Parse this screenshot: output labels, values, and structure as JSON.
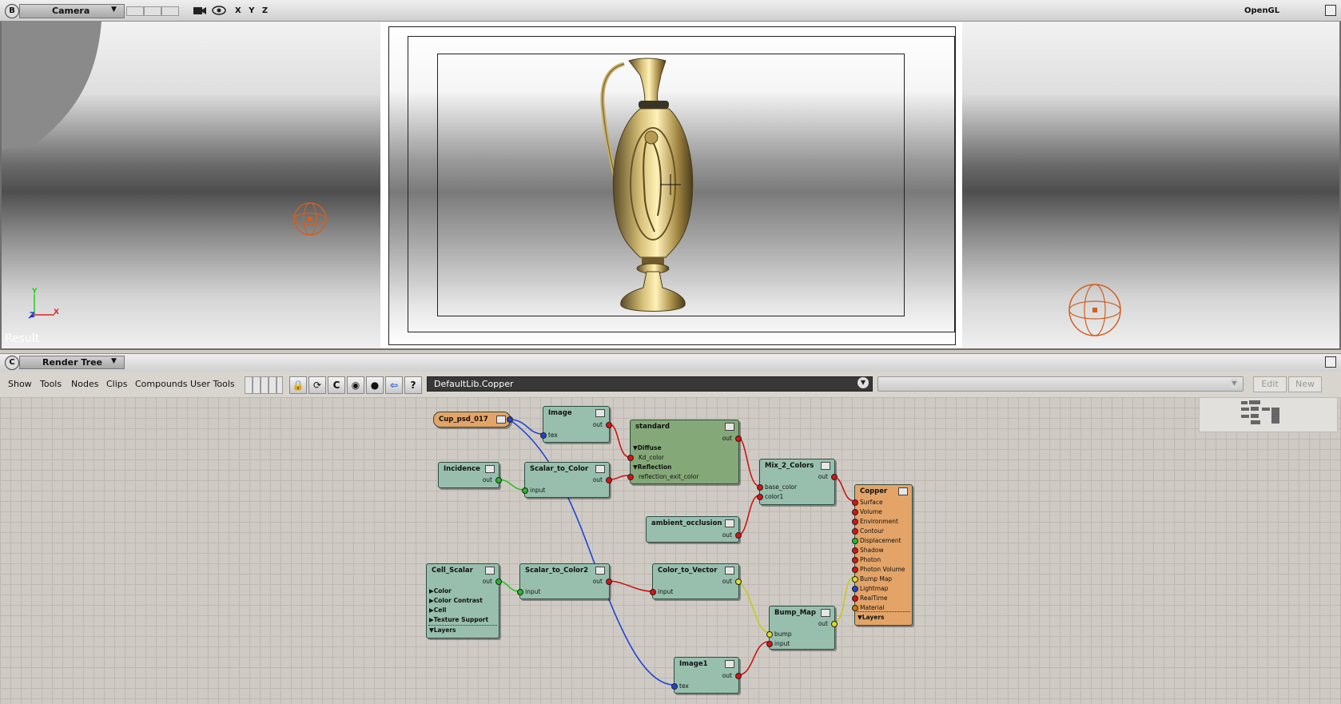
{
  "viewport": {
    "badge": "B",
    "camera_label": "Camera",
    "axes_label": "X Y Z",
    "renderer": "OpenGL",
    "mode_label": "Result",
    "axis_y": "Y",
    "axis_x": "X",
    "axis_z": "Z"
  },
  "render_tree": {
    "badge": "C",
    "title": "Render Tree",
    "menu": [
      "Show",
      "Tools",
      "Nodes",
      "Clips",
      "Compounds",
      "User Tools"
    ],
    "path": "DefaultLib.Copper",
    "edit_label": "Edit",
    "new_label": "New"
  },
  "nodes": {
    "cup": {
      "title": "Cup_psd_017"
    },
    "image": {
      "title": "Image",
      "out": "out",
      "tex": "tex"
    },
    "standard": {
      "title": "standard",
      "out": "out",
      "diffuse": "▼Diffuse",
      "kd_color": "Kd_color",
      "reflection": "▼Reflection",
      "refl_exit": "reflection_exit_color"
    },
    "incidence": {
      "title": "Incidence",
      "out": "out"
    },
    "s2c": {
      "title": "Scalar_to_Color",
      "out": "out",
      "input": "input"
    },
    "mix": {
      "title": "Mix_2_Colors",
      "out": "out",
      "base": "base_color",
      "color1": "color1"
    },
    "ao": {
      "title": "ambient_occlusion",
      "out": "out"
    },
    "cell": {
      "title": "Cell_Scalar",
      "out": "out",
      "color": "▶Color",
      "contrast": "▶Color Contrast",
      "cellp": "▶Cell",
      "texsup": "▶Texture Support",
      "layers": "▼Layers"
    },
    "s2c2": {
      "title": "Scalar_to_Color2",
      "out": "out",
      "input": "input"
    },
    "c2v": {
      "title": "Color_to_Vector",
      "out": "out",
      "input": "input"
    },
    "bump": {
      "title": "Bump_Map",
      "out": "out",
      "bump": "bump",
      "input": "input"
    },
    "image1": {
      "title": "Image1",
      "out": "out",
      "tex": "tex"
    },
    "copper": {
      "title": "Copper",
      "ports": [
        "Surface",
        "Volume",
        "Environment",
        "Contour",
        "Displacement",
        "Shadow",
        "Photon",
        "Photon Volume",
        "Bump Map",
        "Lightmap",
        "RealTime",
        "Material"
      ],
      "layers": "▼Layers"
    }
  },
  "colors": {
    "node_teal": "#98bfae",
    "node_green": "#85a878",
    "node_orange": "#e4a468",
    "wire_red": "#c81818",
    "wire_blue": "#1f44d6",
    "wire_green": "#2bbf2b",
    "wire_yellow": "#c8c81e"
  }
}
